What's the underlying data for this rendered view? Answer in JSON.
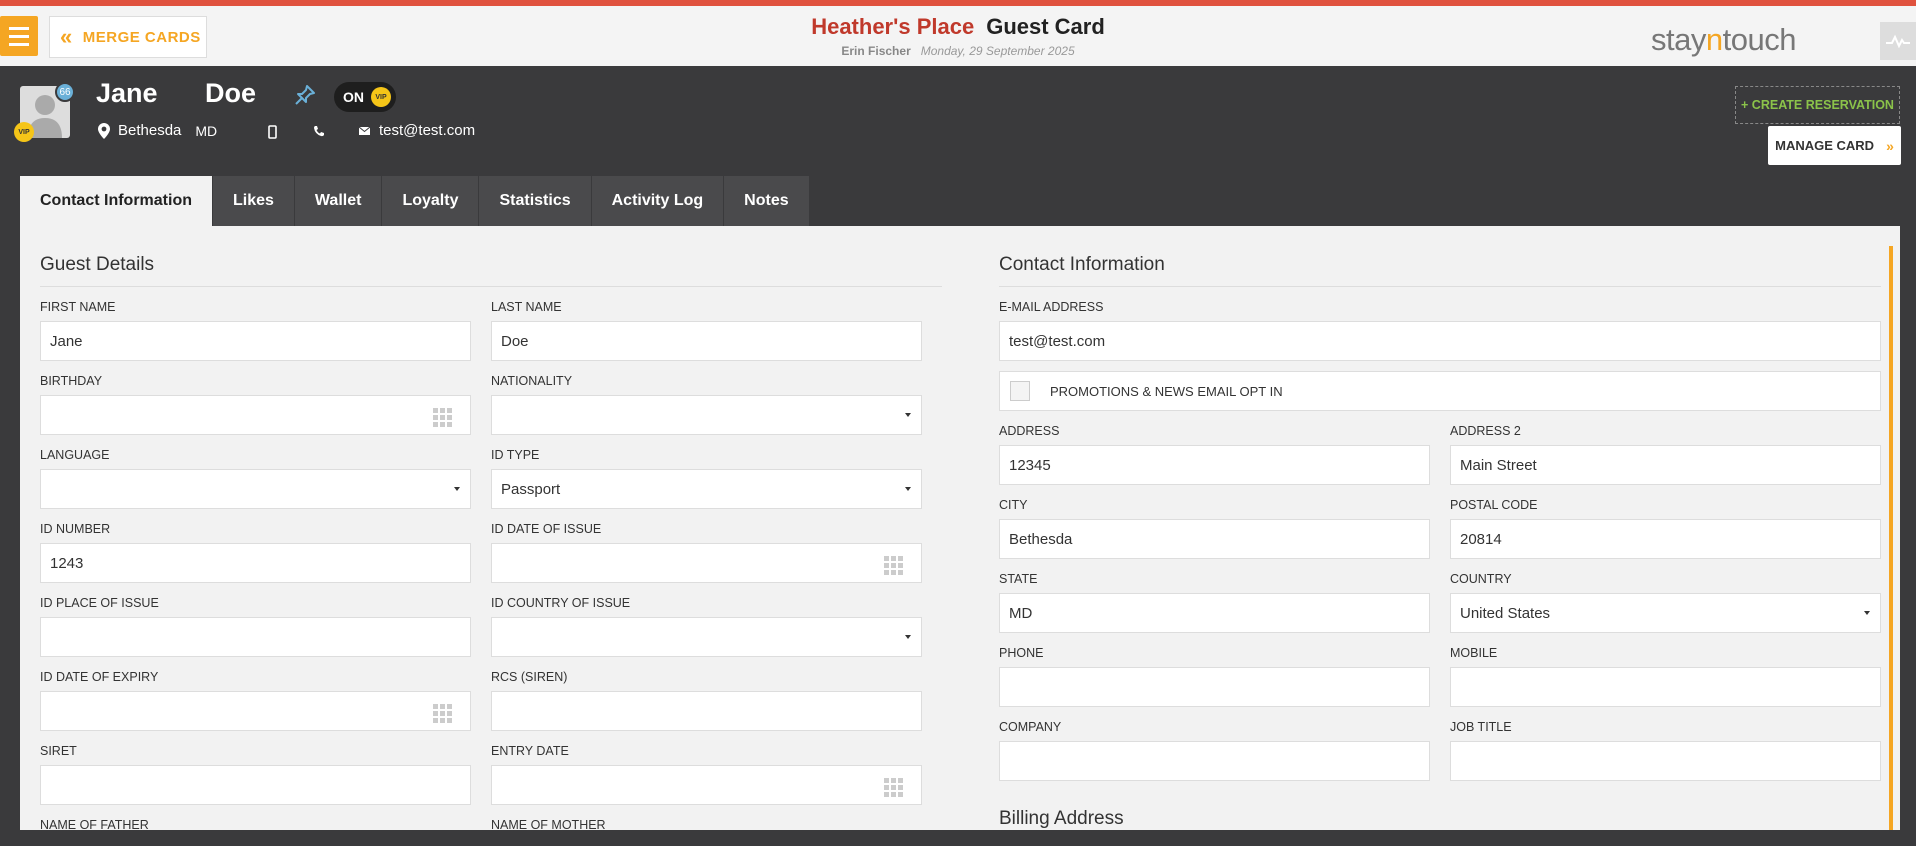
{
  "topbar": {
    "merge_label": "MERGE CARDS",
    "hotel": "Heather's Place",
    "card_title": "Guest Card",
    "user": "Erin Fischer",
    "date": "Monday, 29 September 2025",
    "logo_a": "stay",
    "logo_b": "n",
    "logo_c": "touch"
  },
  "guest": {
    "first_name": "Jane",
    "last_name": "Doe",
    "badge_count": "66",
    "vip_badge": "VIP",
    "vip_toggle_label": "ON",
    "city": "Bethesda",
    "state": "MD",
    "email": "test@test.com"
  },
  "actions": {
    "create_reservation": "+ CREATE RESERVATION",
    "manage_card": "MANAGE CARD"
  },
  "tabs": [
    {
      "label": "Contact Information"
    },
    {
      "label": "Likes"
    },
    {
      "label": "Wallet"
    },
    {
      "label": "Loyalty"
    },
    {
      "label": "Statistics"
    },
    {
      "label": "Activity Log"
    },
    {
      "label": "Notes"
    }
  ],
  "guest_details": {
    "title": "Guest Details",
    "first_name_label": "FIRST NAME",
    "first_name": "Jane",
    "last_name_label": "LAST NAME",
    "last_name": "Doe",
    "birthday_label": "BIRTHDAY",
    "nationality_label": "NATIONALITY",
    "language_label": "LANGUAGE",
    "id_type_label": "ID TYPE",
    "id_type": "Passport",
    "id_number_label": "ID NUMBER",
    "id_number": "1243",
    "id_date_issue_label": "ID DATE OF ISSUE",
    "id_place_issue_label": "ID PLACE OF ISSUE",
    "id_country_issue_label": "ID COUNTRY OF ISSUE",
    "id_date_expiry_label": "ID DATE OF EXPIRY",
    "rcs_label": "RCS (SIREN)",
    "siret_label": "SIRET",
    "entry_date_label": "ENTRY DATE",
    "father_label": "NAME OF FATHER",
    "mother_label": "NAME OF MOTHER"
  },
  "contact": {
    "title": "Contact Information",
    "email_label": "E-MAIL ADDRESS",
    "email": "test@test.com",
    "optin_label": "PROMOTIONS & NEWS EMAIL OPT IN",
    "address_label": "ADDRESS",
    "address": "12345",
    "address2_label": "ADDRESS 2",
    "address2": "Main Street",
    "city_label": "CITY",
    "city": "Bethesda",
    "postal_label": "POSTAL CODE",
    "postal": "20814",
    "state_label": "STATE",
    "state": "MD",
    "country_label": "COUNTRY",
    "country": "United States",
    "phone_label": "PHONE",
    "mobile_label": "MOBILE",
    "company_label": "COMPANY",
    "job_label": "JOB TITLE",
    "billing_title": "Billing Address"
  }
}
